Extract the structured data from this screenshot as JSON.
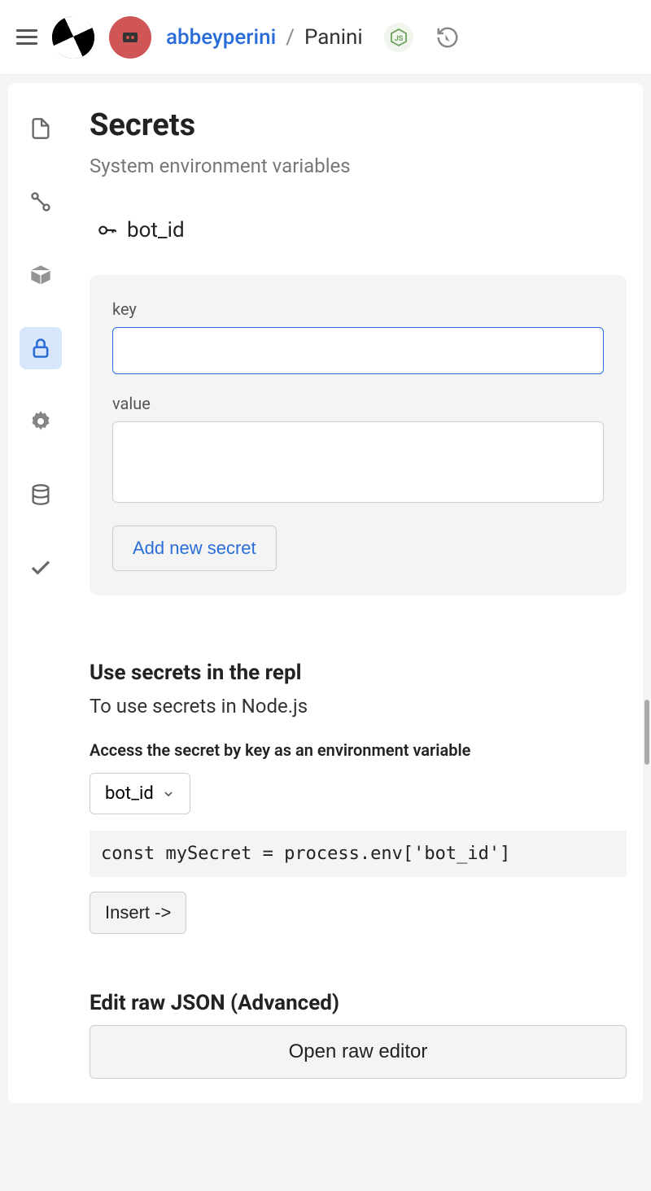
{
  "header": {
    "user": "abbeyperini",
    "separator": "/",
    "project": "Panini"
  },
  "page": {
    "title": "Secrets",
    "subtitle": "System environment variables"
  },
  "secrets": [
    {
      "name": "bot_id"
    }
  ],
  "form": {
    "key_label": "key",
    "key_value": "",
    "value_label": "value",
    "value_value": "",
    "add_button": "Add new secret"
  },
  "usage": {
    "title": "Use secrets in the repl",
    "desc": "To use secrets in Node.js",
    "help": "Access the secret by key as an environment variable",
    "dropdown_value": "bot_id",
    "code": "const mySecret = process.env['bot_id']",
    "insert_label": "Insert ->"
  },
  "advanced": {
    "title": "Edit raw JSON (Advanced)",
    "button": "Open raw editor"
  }
}
